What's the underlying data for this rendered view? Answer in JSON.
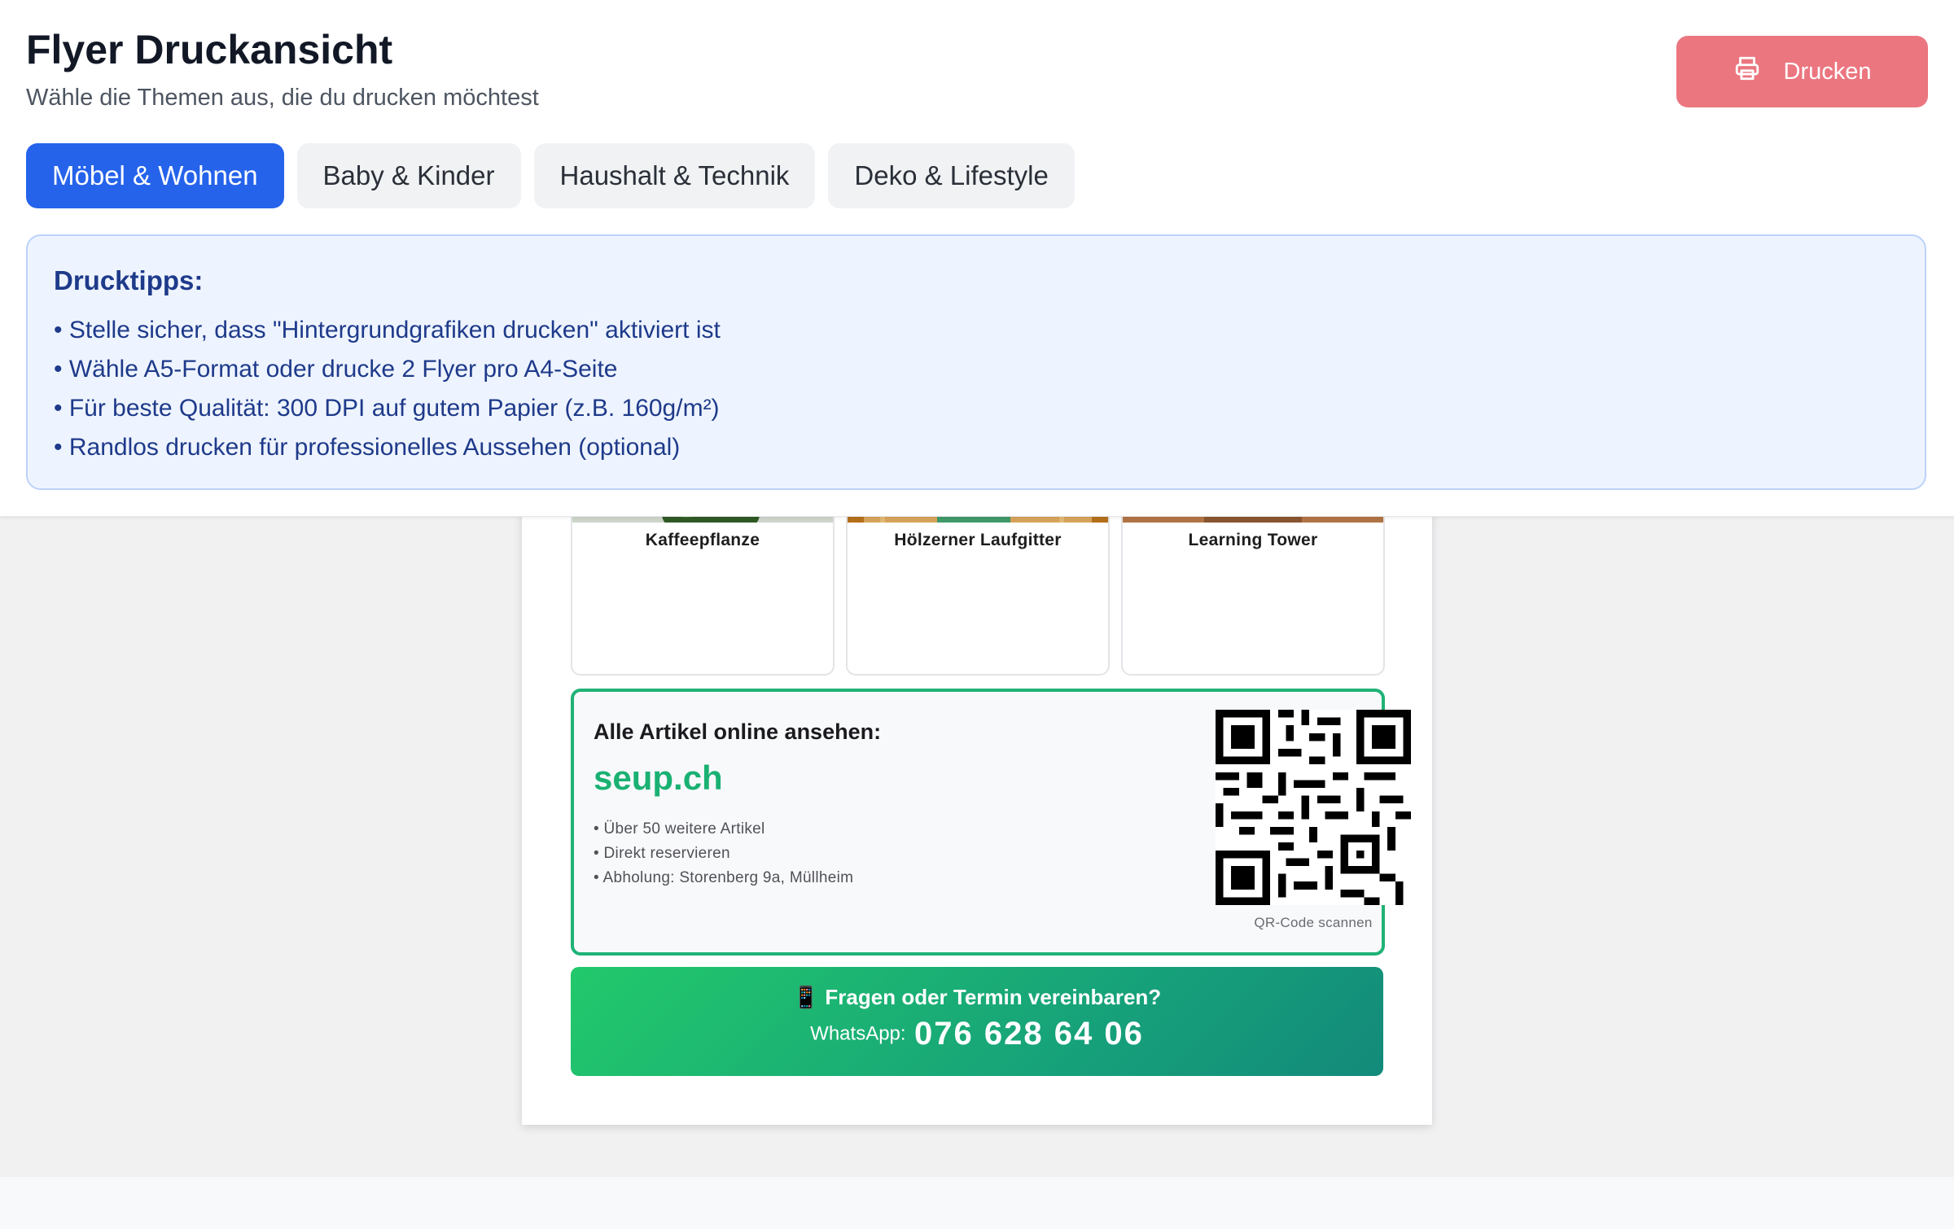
{
  "header": {
    "title": "Flyer Druckansicht",
    "subtitle": "Wähle die Themen aus, die du drucken möchtest",
    "print_button": {
      "label": "Drucken",
      "icon": "printer-icon",
      "color": "#eb7680"
    }
  },
  "tabs": [
    {
      "label": "Möbel & Wohnen",
      "active": true
    },
    {
      "label": "Baby & Kinder",
      "active": false
    },
    {
      "label": "Haushalt & Technik",
      "active": false
    },
    {
      "label": "Deko & Lifestyle",
      "active": false
    }
  ],
  "tips": {
    "title": "Drucktipps:",
    "items": [
      "Stelle sicher, dass \"Hintergrundgrafiken drucken\" aktiviert ist",
      "Wähle A5-Format oder drucke 2 Flyer pro A4-Seite",
      "Für beste Qualität: 300 DPI auf gutem Papier (z.B. 160g/m²)",
      "Randlos drucken für professionelles Aussehen (optional)"
    ]
  },
  "flyer": {
    "products": [
      {
        "name": "Kaffeepflanze"
      },
      {
        "name": "Hölzerner Laufgitter"
      },
      {
        "name": "Learning Tower"
      }
    ],
    "online": {
      "heading": "Alle Artikel online ansehen:",
      "site": "seup.ch",
      "bullets": [
        "Über 50 weitere Artikel",
        "Direkt reservieren",
        "Abholung: Storenberg 9a, Müllheim"
      ],
      "qr_caption": "QR-Code scannen"
    },
    "contact": {
      "line1": "📱 Fragen oder Termin vereinbaren?",
      "label": "WhatsApp:",
      "number": "076 628 64 06"
    }
  },
  "colors": {
    "accent_blue": "#2563eb",
    "green": "#1ab173",
    "print_red": "#eb7680"
  }
}
